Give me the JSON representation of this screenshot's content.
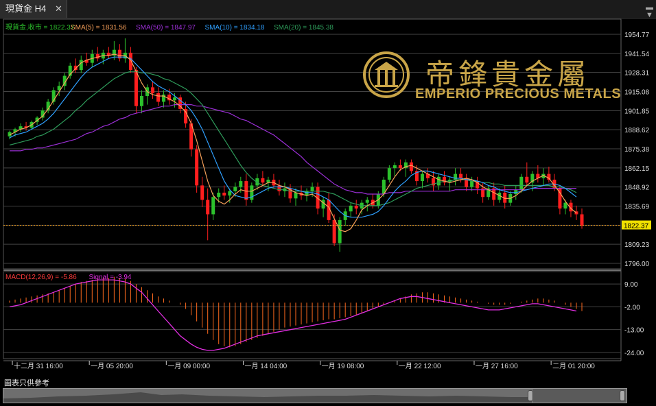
{
  "tab": {
    "title": "現貨金 H4",
    "close": "✕"
  },
  "logo": {
    "cn": "帝鋒貴金屬",
    "en": "EMPERIO PRECIOUS METALS"
  },
  "footer_note": "圖表只供參考",
  "colors": {
    "sma5": "#f7a05a",
    "sma50": "#9b2fd6",
    "sma10": "#2fa0ff",
    "sma20": "#2e9b5a",
    "up": "#2cc12c",
    "down": "#ff1e1e",
    "macd_hist": "#ff6a1e",
    "signal": "#e22ee2",
    "gold": "#c9a548"
  },
  "chart_data": [
    {
      "type": "line",
      "title": "",
      "legend": [
        {
          "label": "現貨金,收市 = 1822.37",
          "color": "#2cc12c"
        },
        {
          "label": "SMA(5) = 1831.56",
          "color": "#f7a05a"
        },
        {
          "label": "SMA(50) = 1847.97",
          "color": "#9b2fd6"
        },
        {
          "label": "SMA(10) = 1834.18",
          "color": "#2fa0ff"
        },
        {
          "label": "SMA(20) = 1845.38",
          "color": "#2e9b5a"
        }
      ],
      "y_ticks": [
        "1954.77",
        "1941.54",
        "1928.31",
        "1915.08",
        "1901.85",
        "1888.62",
        "1875.38",
        "1862.15",
        "1848.92",
        "1835.69",
        "1822.46",
        "1809.23",
        "1796.00"
      ],
      "ylim": [
        1796.0,
        1954.77
      ],
      "last_price": "1822.37",
      "x_ticks": [
        "十二月 31 16:00",
        "一月 05 20:00",
        "一月 09 00:00",
        "一月 14 04:00",
        "一月 19 08:00",
        "一月 22 12:00",
        "一月 27 16:00",
        "二月 01 20:00"
      ],
      "candles": [
        [
          1884,
          1888,
          1882,
          1887
        ],
        [
          1887,
          1890,
          1884,
          1889
        ],
        [
          1889,
          1893,
          1887,
          1891
        ],
        [
          1891,
          1894,
          1888,
          1890
        ],
        [
          1890,
          1895,
          1889,
          1894
        ],
        [
          1894,
          1898,
          1892,
          1897
        ],
        [
          1897,
          1904,
          1895,
          1902
        ],
        [
          1902,
          1910,
          1900,
          1908
        ],
        [
          1908,
          1918,
          1906,
          1916
        ],
        [
          1916,
          1922,
          1912,
          1919
        ],
        [
          1919,
          1928,
          1916,
          1926
        ],
        [
          1926,
          1935,
          1924,
          1933
        ],
        [
          1933,
          1938,
          1928,
          1930
        ],
        [
          1930,
          1940,
          1928,
          1937
        ],
        [
          1937,
          1942,
          1933,
          1935
        ],
        [
          1935,
          1944,
          1932,
          1941
        ],
        [
          1941,
          1946,
          1936,
          1938
        ],
        [
          1938,
          1944,
          1934,
          1942
        ],
        [
          1942,
          1946,
          1938,
          1940
        ],
        [
          1940,
          1950,
          1937,
          1944
        ],
        [
          1944,
          1948,
          1936,
          1938
        ],
        [
          1938,
          1952,
          1935,
          1942
        ],
        [
          1942,
          1946,
          1928,
          1930
        ],
        [
          1930,
          1932,
          1900,
          1905
        ],
        [
          1905,
          1916,
          1900,
          1912
        ],
        [
          1912,
          1920,
          1906,
          1918
        ],
        [
          1918,
          1922,
          1910,
          1914
        ],
        [
          1914,
          1918,
          1905,
          1908
        ],
        [
          1908,
          1916,
          1904,
          1913
        ],
        [
          1913,
          1917,
          1906,
          1909
        ],
        [
          1909,
          1914,
          1904,
          1911
        ],
        [
          1911,
          1913,
          1900,
          1903
        ],
        [
          1903,
          1908,
          1890,
          1893
        ],
        [
          1893,
          1896,
          1870,
          1875
        ],
        [
          1875,
          1878,
          1845,
          1850
        ],
        [
          1850,
          1856,
          1835,
          1840
        ],
        [
          1840,
          1848,
          1812,
          1830
        ],
        [
          1830,
          1845,
          1826,
          1842
        ],
        [
          1842,
          1848,
          1838,
          1845
        ],
        [
          1845,
          1850,
          1840,
          1843
        ],
        [
          1843,
          1848,
          1838,
          1846
        ],
        [
          1846,
          1852,
          1842,
          1849
        ],
        [
          1849,
          1856,
          1845,
          1853
        ],
        [
          1853,
          1858,
          1836,
          1840
        ],
        [
          1840,
          1852,
          1838,
          1850
        ],
        [
          1850,
          1858,
          1847,
          1855
        ],
        [
          1855,
          1860,
          1850,
          1852
        ],
        [
          1852,
          1856,
          1846,
          1854
        ],
        [
          1854,
          1858,
          1848,
          1850
        ],
        [
          1850,
          1854,
          1843,
          1846
        ],
        [
          1846,
          1852,
          1842,
          1848
        ],
        [
          1848,
          1851,
          1838,
          1841
        ],
        [
          1841,
          1848,
          1836,
          1845
        ],
        [
          1845,
          1850,
          1840,
          1843
        ],
        [
          1843,
          1848,
          1839,
          1846
        ],
        [
          1846,
          1852,
          1842,
          1849
        ],
        [
          1849,
          1852,
          1830,
          1834
        ],
        [
          1834,
          1842,
          1828,
          1840
        ],
        [
          1840,
          1845,
          1824,
          1826
        ],
        [
          1826,
          1830,
          1808,
          1810
        ],
        [
          1810,
          1828,
          1804,
          1826
        ],
        [
          1826,
          1834,
          1822,
          1832
        ],
        [
          1832,
          1838,
          1828,
          1836
        ],
        [
          1836,
          1840,
          1830,
          1834
        ],
        [
          1834,
          1840,
          1830,
          1838
        ],
        [
          1838,
          1842,
          1832,
          1840
        ],
        [
          1840,
          1844,
          1834,
          1836
        ],
        [
          1836,
          1846,
          1834,
          1844
        ],
        [
          1844,
          1856,
          1842,
          1854
        ],
        [
          1854,
          1864,
          1852,
          1862
        ],
        [
          1862,
          1866,
          1856,
          1864
        ],
        [
          1864,
          1868,
          1860,
          1862
        ],
        [
          1862,
          1868,
          1856,
          1866
        ],
        [
          1866,
          1868,
          1858,
          1860
        ],
        [
          1860,
          1864,
          1850,
          1853
        ],
        [
          1853,
          1860,
          1848,
          1858
        ],
        [
          1858,
          1862,
          1852,
          1855
        ],
        [
          1855,
          1860,
          1846,
          1850
        ],
        [
          1850,
          1858,
          1847,
          1856
        ],
        [
          1856,
          1860,
          1850,
          1852
        ],
        [
          1852,
          1856,
          1846,
          1854
        ],
        [
          1854,
          1862,
          1850,
          1858
        ],
        [
          1858,
          1862,
          1852,
          1855
        ],
        [
          1855,
          1858,
          1846,
          1849
        ],
        [
          1849,
          1856,
          1846,
          1853
        ],
        [
          1853,
          1856,
          1844,
          1848
        ],
        [
          1848,
          1852,
          1838,
          1842
        ],
        [
          1842,
          1850,
          1840,
          1848
        ],
        [
          1848,
          1852,
          1836,
          1840
        ],
        [
          1840,
          1848,
          1838,
          1845
        ],
        [
          1845,
          1850,
          1834,
          1838
        ],
        [
          1838,
          1846,
          1836,
          1844
        ],
        [
          1844,
          1850,
          1840,
          1847
        ],
        [
          1847,
          1858,
          1845,
          1856
        ],
        [
          1856,
          1866,
          1850,
          1852
        ],
        [
          1852,
          1860,
          1846,
          1858
        ],
        [
          1858,
          1864,
          1852,
          1855
        ],
        [
          1855,
          1862,
          1850,
          1858
        ],
        [
          1858,
          1863,
          1852,
          1854
        ],
        [
          1854,
          1858,
          1846,
          1848
        ],
        [
          1848,
          1850,
          1830,
          1834
        ],
        [
          1834,
          1840,
          1830,
          1838
        ],
        [
          1838,
          1840,
          1828,
          1832
        ],
        [
          1832,
          1836,
          1826,
          1830
        ],
        [
          1830,
          1834,
          1820,
          1822
        ]
      ],
      "sma5": [
        1885,
        1887,
        1889,
        1890,
        1892,
        1895,
        1898,
        1903,
        1909,
        1915,
        1921,
        1927,
        1931,
        1935,
        1937,
        1938,
        1939,
        1940,
        1940,
        1941,
        1940,
        1940,
        1937,
        1929,
        1921,
        1915,
        1913,
        1912,
        1912,
        1910,
        1908,
        1905,
        1901,
        1893,
        1881,
        1867,
        1853,
        1843,
        1839,
        1837,
        1840,
        1844,
        1847,
        1846,
        1846,
        1848,
        1850,
        1852,
        1852,
        1850,
        1849,
        1847,
        1845,
        1844,
        1843,
        1844,
        1841,
        1838,
        1835,
        1827,
        1819,
        1818,
        1820,
        1826,
        1833,
        1836,
        1838,
        1840,
        1844,
        1850,
        1856,
        1861,
        1863,
        1864,
        1862,
        1860,
        1858,
        1856,
        1854,
        1853,
        1852,
        1853,
        1854,
        1855,
        1854,
        1852,
        1849,
        1847,
        1845,
        1843,
        1841,
        1841,
        1843,
        1846,
        1850,
        1853,
        1855,
        1857,
        1855,
        1850,
        1845,
        1839,
        1834,
        1831
      ],
      "sma10": [
        1883,
        1885,
        1886,
        1887,
        1889,
        1891,
        1893,
        1896,
        1900,
        1905,
        1910,
        1915,
        1920,
        1925,
        1929,
        1932,
        1934,
        1936,
        1938,
        1939,
        1939,
        1939,
        1938,
        1934,
        1930,
        1926,
        1922,
        1919,
        1917,
        1915,
        1912,
        1909,
        1906,
        1902,
        1896,
        1889,
        1880,
        1871,
        1862,
        1853,
        1847,
        1843,
        1842,
        1841,
        1842,
        1844,
        1846,
        1848,
        1849,
        1849,
        1849,
        1848,
        1847,
        1846,
        1845,
        1845,
        1844,
        1842,
        1840,
        1836,
        1832,
        1829,
        1828,
        1828,
        1828,
        1829,
        1830,
        1832,
        1836,
        1841,
        1846,
        1850,
        1853,
        1857,
        1859,
        1860,
        1860,
        1859,
        1858,
        1857,
        1856,
        1855,
        1855,
        1854,
        1854,
        1853,
        1852,
        1850,
        1849,
        1847,
        1846,
        1845,
        1845,
        1846,
        1847,
        1848,
        1849,
        1850,
        1851,
        1851,
        1850,
        1848,
        1845,
        1842
      ],
      "sma20": [
        1878,
        1879,
        1880,
        1881,
        1882,
        1884,
        1885,
        1887,
        1889,
        1892,
        1895,
        1898,
        1902,
        1905,
        1909,
        1912,
        1915,
        1918,
        1921,
        1924,
        1926,
        1928,
        1929,
        1929,
        1928,
        1928,
        1927,
        1926,
        1924,
        1923,
        1921,
        1919,
        1917,
        1914,
        1910,
        1906,
        1900,
        1894,
        1888,
        1882,
        1876,
        1870,
        1864,
        1859,
        1855,
        1852,
        1850,
        1849,
        1848,
        1847,
        1847,
        1846,
        1846,
        1846,
        1846,
        1846,
        1846,
        1846,
        1845,
        1844,
        1842,
        1840,
        1838,
        1837,
        1836,
        1836,
        1836,
        1836,
        1837,
        1838,
        1840,
        1842,
        1844,
        1846,
        1848,
        1849,
        1850,
        1851,
        1852,
        1853,
        1853,
        1854,
        1854,
        1854,
        1853,
        1853,
        1852,
        1852,
        1851,
        1851,
        1850,
        1850,
        1850,
        1850,
        1850,
        1850,
        1850,
        1850,
        1850,
        1849,
        1849,
        1848,
        1847,
        1845
      ],
      "sma50": [
        1874,
        1874,
        1874,
        1875,
        1875,
        1876,
        1876,
        1877,
        1878,
        1879,
        1880,
        1881,
        1882,
        1884,
        1886,
        1887,
        1889,
        1891,
        1892,
        1894,
        1896,
        1897,
        1899,
        1900,
        1901,
        1902,
        1903,
        1904,
        1905,
        1905,
        1906,
        1906,
        1906,
        1906,
        1905,
        1905,
        1904,
        1903,
        1902,
        1901,
        1900,
        1898,
        1896,
        1895,
        1893,
        1891,
        1889,
        1887,
        1885,
        1882,
        1879,
        1876,
        1873,
        1870,
        1866,
        1863,
        1860,
        1857,
        1854,
        1851,
        1849,
        1847,
        1846,
        1845,
        1845,
        1844,
        1844,
        1844,
        1844,
        1845,
        1845,
        1845,
        1846,
        1846,
        1846,
        1846,
        1846,
        1846,
        1846,
        1846,
        1846,
        1847,
        1847,
        1847,
        1847,
        1847,
        1847,
        1847,
        1847,
        1847,
        1847,
        1847,
        1847,
        1847,
        1847,
        1848,
        1848,
        1848,
        1848,
        1848,
        1848,
        1848,
        1848,
        1848
      ]
    },
    {
      "type": "bar",
      "title": "",
      "legend": [
        {
          "label": "MACD(12,26,9) = -5.86",
          "color": "#ff3b3b"
        },
        {
          "label": "Signal = -3.94",
          "color": "#e22ee2"
        }
      ],
      "y_ticks": [
        "9.00",
        "-2.00",
        "-13.00",
        "-24.00"
      ],
      "ylim": [
        -27,
        15
      ],
      "histogram": [
        1,
        1.5,
        2,
        2.5,
        3,
        3.5,
        4,
        4.5,
        5,
        6,
        7,
        8,
        9,
        10,
        10.5,
        11,
        11.5,
        12,
        12,
        12.5,
        12,
        11.5,
        10.5,
        9,
        7.5,
        6,
        4.5,
        3,
        2,
        1,
        0,
        -1,
        -3,
        -6,
        -9,
        -12,
        -15,
        -18,
        -20,
        -21,
        -21.5,
        -21,
        -20,
        -19,
        -18,
        -17,
        -16,
        -15,
        -14,
        -13,
        -12,
        -11.5,
        -11,
        -10.5,
        -10,
        -9.5,
        -9,
        -8.5,
        -8,
        -8,
        -7.5,
        -7,
        -6.5,
        -6,
        -5,
        -4,
        -3,
        -2,
        -1,
        0,
        1,
        2,
        3,
        4,
        4.5,
        5,
        5,
        4.5,
        4,
        3.5,
        3,
        2.5,
        2,
        1.5,
        1,
        0.5,
        0,
        -0.5,
        -1,
        -1,
        -1,
        -0.5,
        0,
        0.5,
        1,
        1.5,
        2,
        2,
        1.5,
        1,
        0,
        -1,
        -2,
        -3,
        -4
      ],
      "signal": [
        -2,
        -1.5,
        -1,
        0,
        1,
        2,
        3,
        4,
        5,
        6,
        7,
        8,
        9,
        9.5,
        10,
        10.5,
        11,
        11,
        11,
        11,
        10.5,
        10,
        9,
        7,
        5,
        2,
        -1,
        -4,
        -7,
        -10,
        -13,
        -16,
        -18,
        -20,
        -21.5,
        -22.5,
        -23,
        -23,
        -22.5,
        -22,
        -21,
        -20,
        -19,
        -18,
        -17,
        -16,
        -15.5,
        -15,
        -14.5,
        -14,
        -13.5,
        -13,
        -12.5,
        -12,
        -11.5,
        -11,
        -10.5,
        -10,
        -9.5,
        -9,
        -8.5,
        -8,
        -7,
        -6,
        -5,
        -4,
        -3,
        -2,
        -1,
        0,
        1,
        2,
        2.5,
        3,
        3,
        2.5,
        2,
        1.5,
        1,
        0.5,
        0,
        -0.5,
        -1,
        -1.5,
        -2,
        -2.5,
        -3,
        -3.5,
        -3.5,
        -3.5,
        -3,
        -2.5,
        -2,
        -1.5,
        -1,
        -0.5,
        -0.5,
        -1,
        -1.5,
        -2,
        -2.5,
        -3,
        -3.5,
        -4
      ]
    }
  ]
}
